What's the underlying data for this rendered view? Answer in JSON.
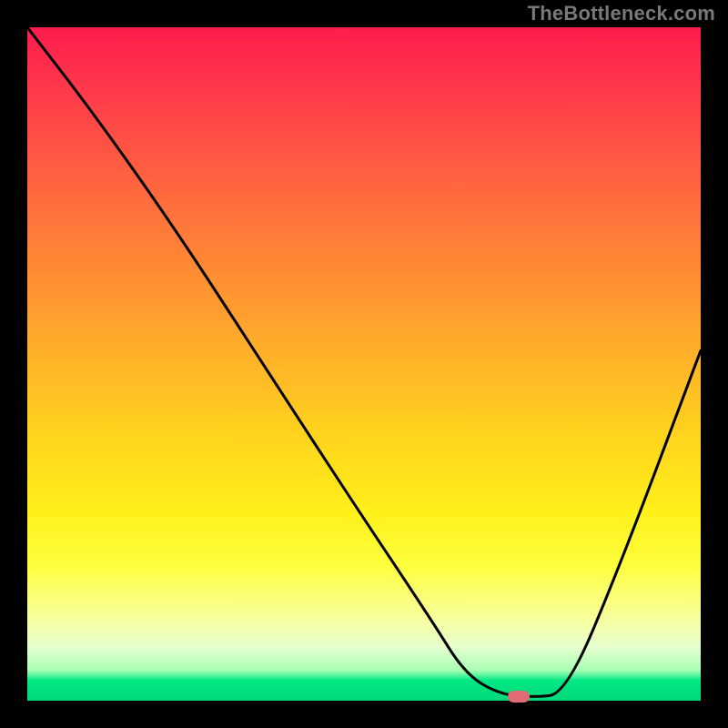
{
  "watermark": "TheBottleneck.com",
  "chart_data": {
    "type": "line",
    "title": "",
    "xlabel": "",
    "ylabel": "",
    "xlim": [
      0,
      100
    ],
    "ylim": [
      0,
      100
    ],
    "grid": false,
    "legend": false,
    "background_gradient": {
      "direction": "vertical",
      "stops": [
        {
          "pos": 0.0,
          "color": "#ff1c4d"
        },
        {
          "pos": 0.1,
          "color": "#ff3b4a"
        },
        {
          "pos": 0.25,
          "color": "#ff6a3e"
        },
        {
          "pos": 0.45,
          "color": "#ffa62c"
        },
        {
          "pos": 0.6,
          "color": "#ffd21e"
        },
        {
          "pos": 0.72,
          "color": "#fff01a"
        },
        {
          "pos": 0.8,
          "color": "#fdff3f"
        },
        {
          "pos": 0.88,
          "color": "#f8ffa0"
        },
        {
          "pos": 0.92,
          "color": "#e6ffcf"
        },
        {
          "pos": 0.955,
          "color": "#a8ffb4"
        },
        {
          "pos": 0.97,
          "color": "#00e884"
        },
        {
          "pos": 1.0,
          "color": "#00d879"
        }
      ]
    },
    "series": [
      {
        "name": "bottleneck-curve",
        "x": [
          0,
          10,
          22,
          35,
          48,
          60,
          65,
          70,
          75,
          80,
          88,
          100
        ],
        "y": [
          100,
          87,
          70,
          50,
          30,
          12,
          4,
          1,
          0.5,
          1,
          20,
          52
        ],
        "stroke": "#000000",
        "stroke_width": 3
      }
    ],
    "marker": {
      "name": "optimal-point",
      "x": 73,
      "y": 0.5,
      "color": "#e16b72",
      "shape": "pill"
    }
  }
}
